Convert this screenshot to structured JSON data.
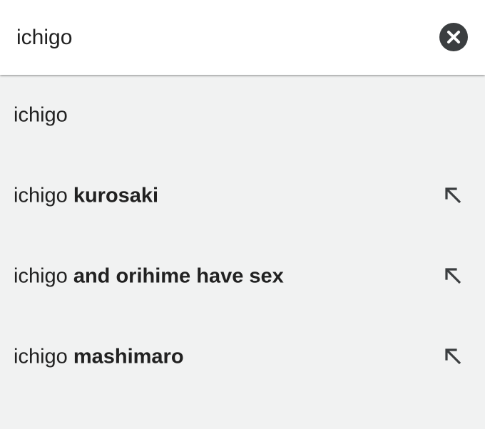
{
  "search": {
    "query": "ichigo",
    "clear_icon": "close-circle-icon"
  },
  "colors": {
    "search_bar_bg": "#ffffff",
    "list_bg": "#f1f2f2",
    "text": "#212121",
    "icon": "#3b3e40"
  },
  "suggestions": [
    {
      "prefix": "ichigo",
      "suffix": "",
      "fill_icon": ""
    },
    {
      "prefix": "ichigo ",
      "suffix": "kurosaki",
      "fill_icon": "arrow-up-left-icon"
    },
    {
      "prefix": "ichigo ",
      "suffix": "and orihime have sex",
      "fill_icon": "arrow-up-left-icon"
    },
    {
      "prefix": "ichigo ",
      "suffix": "mashimaro",
      "fill_icon": "arrow-up-left-icon"
    }
  ]
}
